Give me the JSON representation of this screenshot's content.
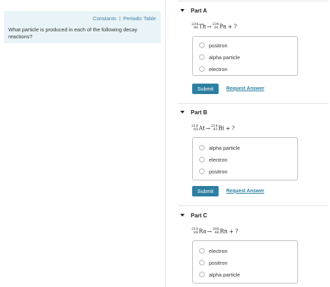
{
  "intro": {
    "link_constants": "Constants",
    "separator": "|",
    "link_periodic_table": "Periodic Table",
    "question": "What particle is produced in each of the following decay reactions?"
  },
  "parts": [
    {
      "title": "Part A",
      "equation": {
        "reactant": {
          "mass": "234",
          "atomic": "90",
          "symbol": "Th"
        },
        "arrow": "→",
        "product": {
          "mass": "234",
          "atomic": "91",
          "symbol": "Pa"
        },
        "plus": "+",
        "unknown": "?"
      },
      "choices": [
        "positron",
        "alpha particle",
        "electron"
      ],
      "submit_label": "Submit",
      "request_label": "Request Answer"
    },
    {
      "title": "Part B",
      "equation": {
        "reactant": {
          "mass": "218",
          "atomic": "85",
          "symbol": "At"
        },
        "arrow": "→",
        "product": {
          "mass": "214",
          "atomic": "83",
          "symbol": "Bi"
        },
        "plus": "+",
        "unknown": "?"
      },
      "choices": [
        "alpha particle",
        "electron",
        "positron"
      ],
      "submit_label": "Submit",
      "request_label": "Request Answer"
    },
    {
      "title": "Part C",
      "equation": {
        "reactant": {
          "mass": "210",
          "atomic": "88",
          "symbol": "Ra"
        },
        "arrow": "→",
        "product": {
          "mass": "206",
          "atomic": "86",
          "symbol": "Rn"
        },
        "plus": "+",
        "unknown": "?"
      },
      "choices": [
        "electron",
        "positron",
        "alpha particle"
      ]
    }
  ]
}
